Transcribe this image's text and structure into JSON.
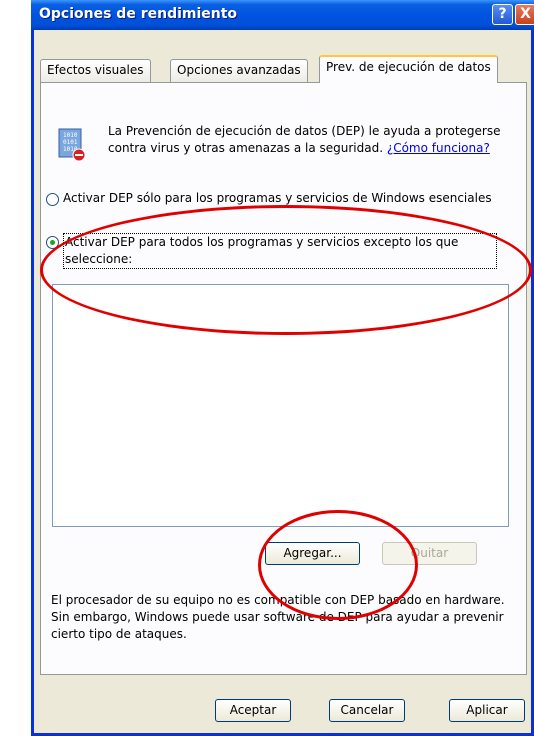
{
  "window": {
    "title": "Opciones de rendimiento",
    "help_icon": "?",
    "close_icon": "X"
  },
  "tabs": [
    {
      "label": "Efectos visuales",
      "active": false
    },
    {
      "label": "Opciones avanzadas",
      "active": false
    },
    {
      "label": "Prev. de ejecución de datos",
      "active": true
    }
  ],
  "dep": {
    "intro_text": "La Prevención de ejecución de datos (DEP) le ayuda a protegerse contra virus y otras amenazas a la seguridad.",
    "link_text": "¿Cómo funciona?",
    "icon": "dep-shield-icon",
    "radio_essential": {
      "label": "Activar DEP sólo para los programas y servicios de Windows esenciales",
      "checked": false
    },
    "radio_all": {
      "label": "Activar DEP para todos los programas y servicios excepto los que seleccione:",
      "checked": true
    },
    "exceptions_list": [],
    "add_button": "Agregar...",
    "remove_button": "Quitar",
    "hardware_text": "El procesador de su equipo no es compatible con DEP basado en hardware. Sin embargo, Windows puede usar software de DEP para ayudar a prevenir cierto tipo de ataques."
  },
  "footer": {
    "ok": "Aceptar",
    "cancel": "Cancelar",
    "apply": "Aplicar"
  },
  "colors": {
    "annotation_ring": "#e00000",
    "titlebar": "#0053e1",
    "dialog_bg": "#ece9d8"
  }
}
